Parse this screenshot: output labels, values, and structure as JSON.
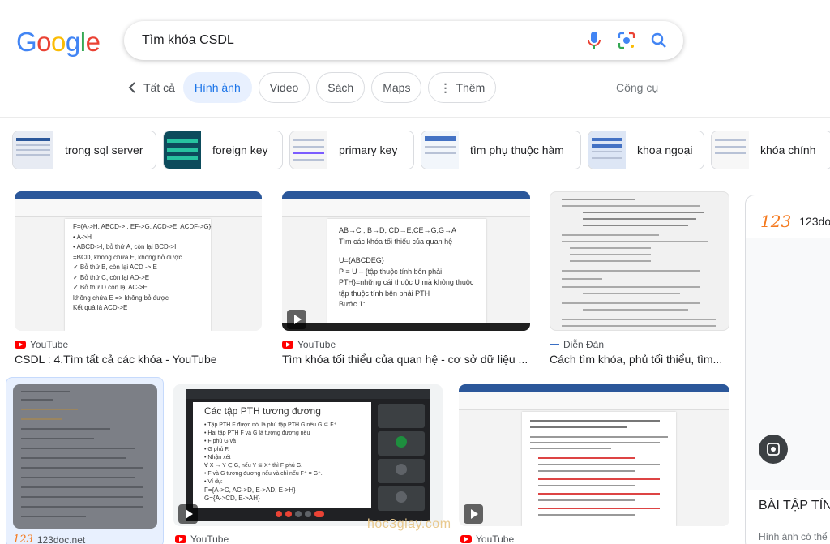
{
  "search": {
    "query": "Tìm khóa CSDL"
  },
  "tabs": {
    "back_label": "Tất cả",
    "items": [
      "Hình ảnh",
      "Video",
      "Sách",
      "Maps",
      "Thêm"
    ],
    "active": 0,
    "tools": "Công cụ"
  },
  "related": [
    "trong sql server",
    "foreign key",
    "primary key",
    "tìm phụ thuộc hàm",
    "khoa ngoại",
    "khóa chính"
  ],
  "results": [
    {
      "source": "YouTube",
      "title": "CSDL : 4.Tìm tất cả các khóa - YouTube"
    },
    {
      "source": "YouTube",
      "title": "Tìm khóa tối thiểu của quan hệ - cơ sở dữ liệu ..."
    },
    {
      "source": "Diễn Đàn",
      "title": "Cách tìm khóa, phủ tối thiểu, tìm..."
    },
    {
      "source": "123doc.net",
      "title": ""
    },
    {
      "source": "YouTube",
      "title": ""
    },
    {
      "source": "YouTube",
      "title": ""
    }
  ],
  "thumb_text": {
    "r1": [
      "F={A->H, ABCD->I, EF->G, ACD->E, ACDF->G}",
      "• A->H",
      "• ABCD->I, bỏ thứ A, còn lại BCD->I",
      "=BCD, không chứa E, không bỏ được.",
      "✓ Bỏ thứ B, còn lại ACD -> E",
      "✓ Bỏ thứ C, còn lại AD->E",
      "✓ Bỏ thứ D còn lại AC->E",
      "không chứa E => không bỏ được",
      "Kết quả là ACD->E"
    ],
    "r2": [
      "AB→C , B→D, CD→E,CE→G,G→A",
      "Tìm các khóa tối thiểu của quan hệ",
      "U={ABCDEG}",
      "P = U – {tập thuộc tính bên phải",
      "PTH}=những cái thuộc U mà không thuộc",
      "tập thuộc tính bên phải PTH",
      "Bước 1:"
    ],
    "r5": [
      "Các tập PTH tương đương",
      "• Tập PTH F được nói là phủ tập PTH G nếu G ⊆ F⁺.",
      "• Hai tập PTH F và G là tương đương nếu",
      "   • F phủ G và",
      "   • G phủ F.",
      "• Nhận xét",
      "   ∀ X → Y ∈ G, nếu Y ⊆ X⁺ thì F phủ G.",
      "   • F và G tương đương nếu và chỉ nếu F⁺ = G⁺.",
      "• Ví dụ:",
      "F={A->C, AC->D, E->AD, E->H}",
      "G={A->CD, E->AH}"
    ]
  },
  "side": {
    "source": "123doc",
    "title": "BÀI TẬP TÍN",
    "caption": "Hình ảnh có thể"
  },
  "watermark": "hoc3giay.com"
}
